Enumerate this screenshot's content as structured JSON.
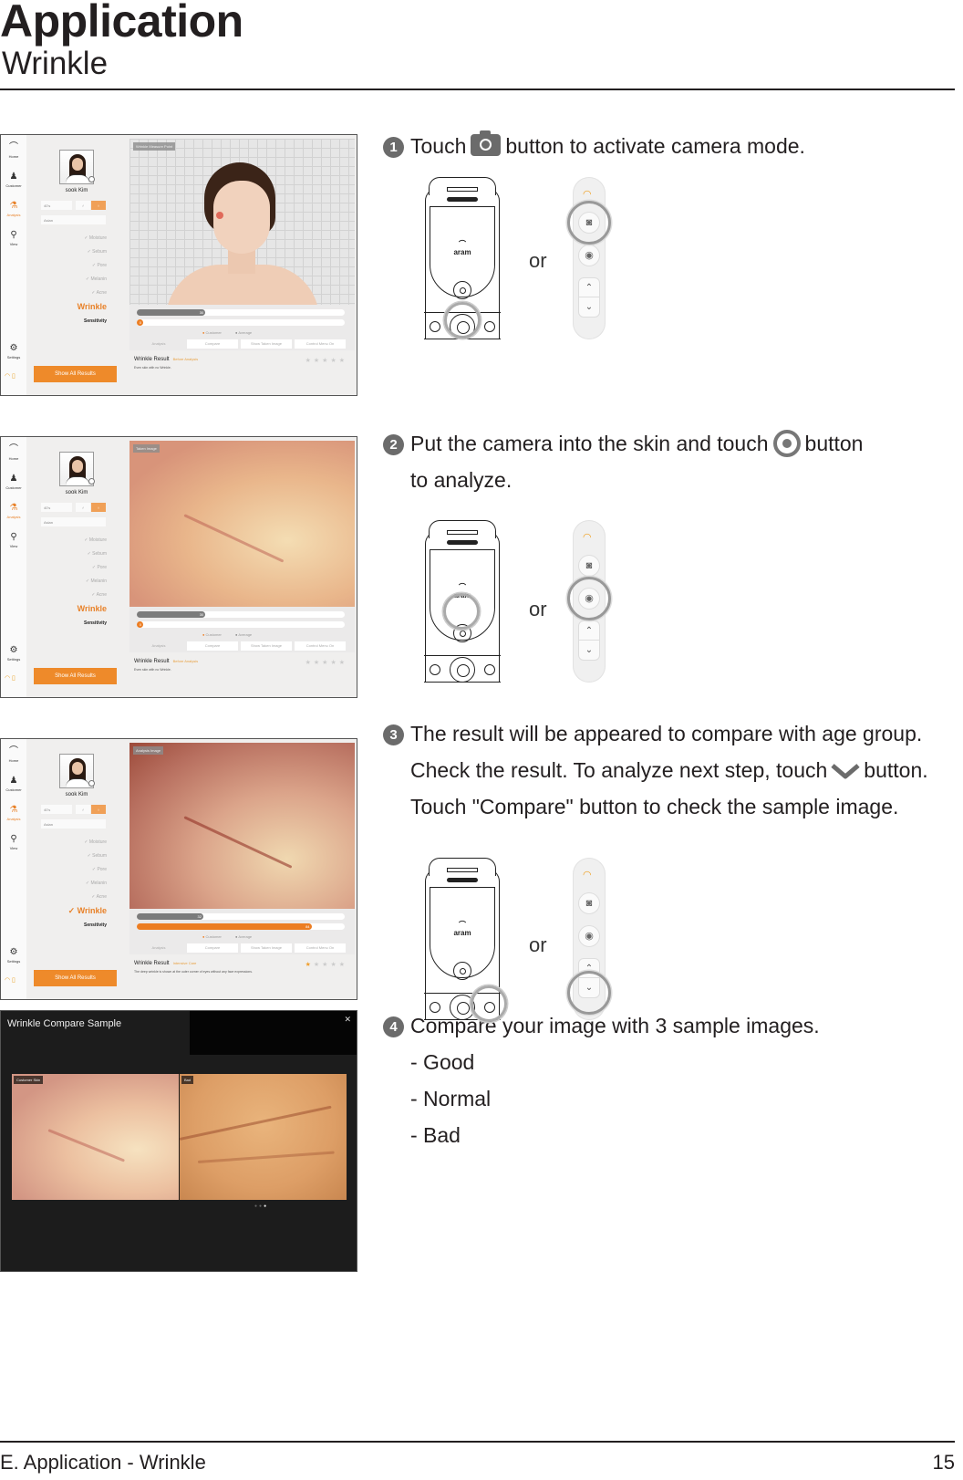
{
  "header": {
    "title": "Application",
    "subtitle": "Wrinkle"
  },
  "footer": {
    "section": "E. Application - Wrinkle",
    "page_number": "15"
  },
  "app": {
    "nav": [
      {
        "label": "Home",
        "icon": "home-icon"
      },
      {
        "label": "Customer",
        "icon": "customer-icon"
      },
      {
        "label": "Analysis",
        "icon": "microscope-icon"
      },
      {
        "label": "View",
        "icon": "search-icon"
      },
      {
        "label": "Settings",
        "icon": "gear-icon"
      }
    ],
    "customer_name": "sook Kim",
    "age_group": "40's",
    "ethnicity": "Asian",
    "menu": [
      "Moisture",
      "Sebum",
      "Pore",
      "Melanin",
      "Acne",
      "Wrinkle",
      "Sensitivity"
    ],
    "show_all_results": "Show All Results",
    "legend": {
      "customer": "Customer",
      "average": "Average"
    },
    "tabs": [
      "Analysis",
      "Compare",
      "Show Taken Image",
      "Control Menu On"
    ],
    "result_title": "Wrinkle Result",
    "accent_color": "#ee8a2a"
  },
  "screens": [
    {
      "viewer_label": "Wrinkle Measure Point",
      "average_value": "30",
      "average_fraction": 0.33,
      "customer_value": "0",
      "customer_fraction": 0.0,
      "result_tag": "Before Analysis",
      "result_desc": "Even skin with no Wrinkle.",
      "stars_on": 0
    },
    {
      "viewer_label": "Taken Image",
      "average_value": "30",
      "average_fraction": 0.33,
      "customer_value": "0",
      "customer_fraction": 0.0,
      "result_tag": "Before Analysis",
      "result_desc": "Even skin with no Wrinkle.",
      "stars_on": 0
    },
    {
      "viewer_label": "Analysis Image",
      "average_value": "32",
      "average_fraction": 0.32,
      "customer_value": "84",
      "customer_fraction": 0.84,
      "result_tag": "Intensive Care",
      "result_desc": "The deep wrinkle is shown at the outer corner of eyes without any face expressions.",
      "stars_on": 1
    }
  ],
  "compare_modal": {
    "title": "Wrinkle Compare Sample",
    "left_label": "Customer Skin",
    "right_label": "Bad",
    "pages": 3,
    "current_page": 3
  },
  "steps": [
    {
      "number": "1",
      "lines": [
        {
          "before": "Touch",
          "icon": "camera-icon",
          "after": "button to activate camera mode."
        }
      ],
      "or_label": "or"
    },
    {
      "number": "2",
      "lines": [
        {
          "before": "Put the camera into the skin and touch",
          "icon": "shutter-target-icon",
          "after": "button"
        },
        {
          "text": "to analyze."
        }
      ],
      "or_label": "or"
    },
    {
      "number": "3",
      "lines": [
        {
          "text": "The result will be appeared to compare with age group."
        },
        {
          "before": "Check the result. To analyze next step, touch",
          "icon": "chevron-down-icon",
          "after": "button."
        },
        {
          "text": "Touch \"Compare\" button to check the sample image."
        }
      ],
      "or_label": "or"
    },
    {
      "number": "4",
      "lines": [
        {
          "text": "Compare your image with 3 sample images."
        },
        {
          "text": "- Good"
        },
        {
          "text": "- Normal"
        },
        {
          "text": "- Bad"
        }
      ]
    }
  ],
  "device": {
    "brand": "aram"
  }
}
